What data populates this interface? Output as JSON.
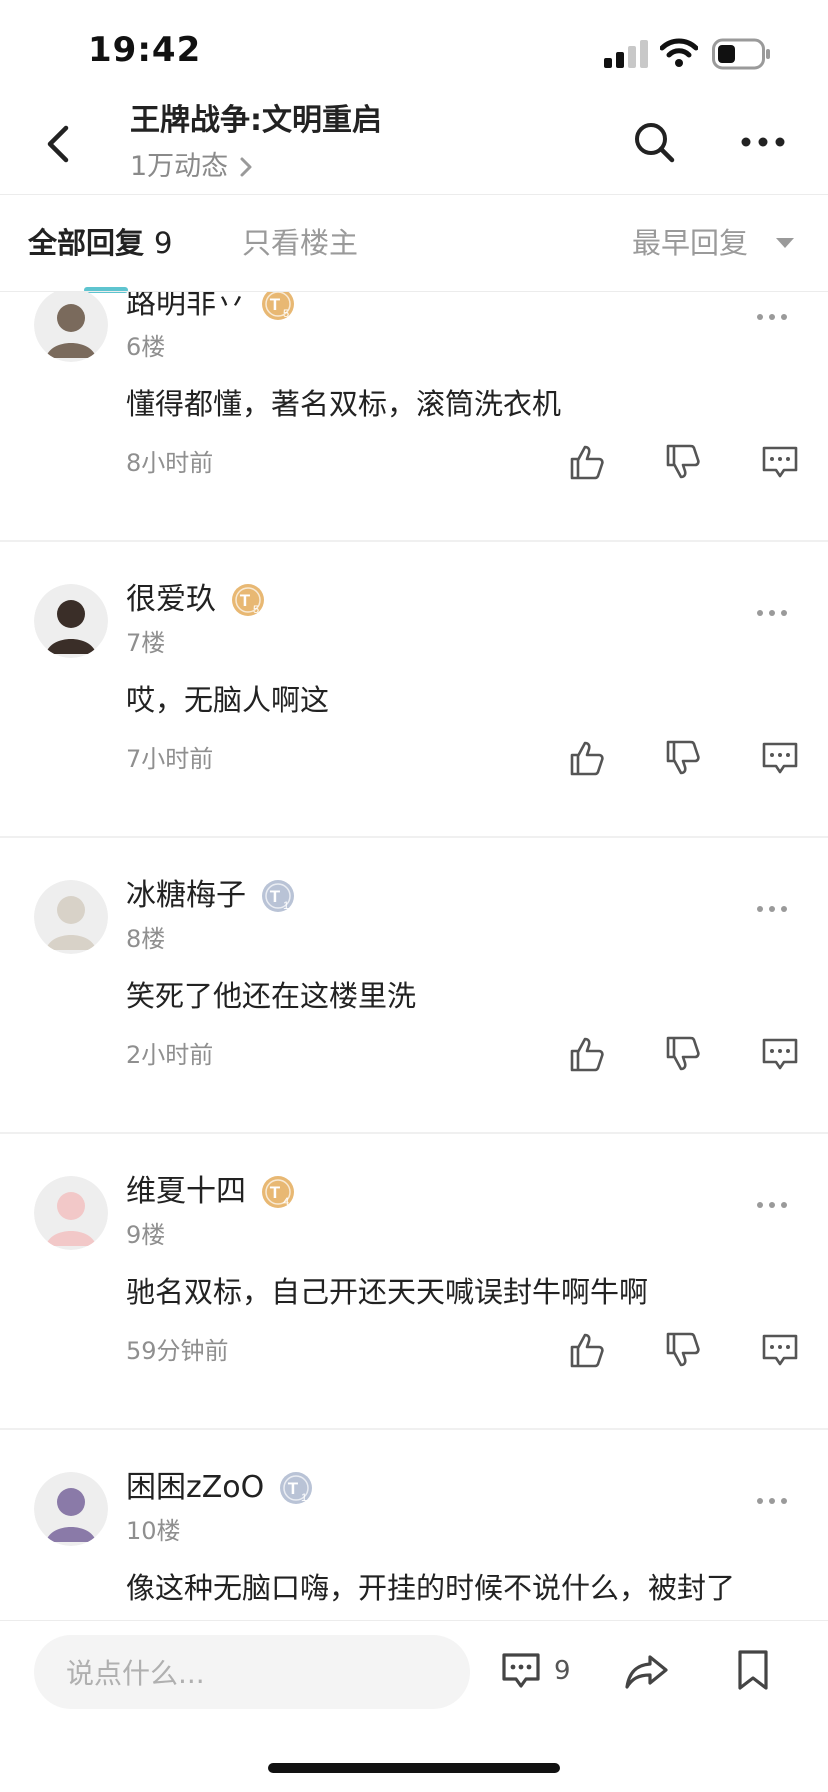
{
  "status_bar": {
    "time": "19:42"
  },
  "header": {
    "title": "王牌战争:文明重启",
    "subtitle": "1万动态"
  },
  "tabs": {
    "all_label": "全部回复",
    "all_count": "9",
    "op_only_label": "只看楼主",
    "sort_label": "最早回复"
  },
  "comments": [
    {
      "username": "路明非丷",
      "badge_level": "5",
      "badge_color": "#e8b873",
      "floor": "6楼",
      "text": "懂得都懂，著名双标，滚筒洗衣机",
      "time": "8小时前",
      "avatar_color": "#7a6a5c"
    },
    {
      "username": "很爱玖",
      "badge_level": "5",
      "badge_color": "#e8b873",
      "floor": "7楼",
      "text": "哎，无脑人啊这",
      "time": "7小时前",
      "avatar_color": "#3a2e28"
    },
    {
      "username": "冰糖梅子",
      "badge_level": "1",
      "badge_color": "#b9c3d6",
      "floor": "8楼",
      "text": "笑死了他还在这楼里洗",
      "time": "2小时前",
      "avatar_color": "#d8d2c8"
    },
    {
      "username": "维夏十四",
      "badge_level": "4",
      "badge_color": "#e8b873",
      "floor": "9楼",
      "text": "驰名双标，自己开还天天喊误封牛啊牛啊",
      "time": "59分钟前",
      "avatar_color": "#f2c8c8"
    },
    {
      "username": "困困zZoO",
      "badge_level": "1",
      "badge_color": "#b9c3d6",
      "floor": "10楼",
      "text": "像这种无脑口嗨，开挂的时候不说什么，被封了",
      "time": "",
      "avatar_color": "#8a7aa8"
    }
  ],
  "bottom_bar": {
    "input_placeholder": "说点什么...",
    "comment_count": "9"
  },
  "colors": {
    "accent": "#5ec4cf",
    "muted_text": "#8f8f8f",
    "gold_badge": "#e8b873",
    "silver_badge": "#b9c3d6"
  },
  "icons": [
    "back-icon",
    "search-icon",
    "more-icon",
    "caret-down-icon",
    "thumbs-up-icon",
    "thumbs-down-icon",
    "reply-icon",
    "comment-icon",
    "share-icon",
    "bookmark-icon"
  ]
}
